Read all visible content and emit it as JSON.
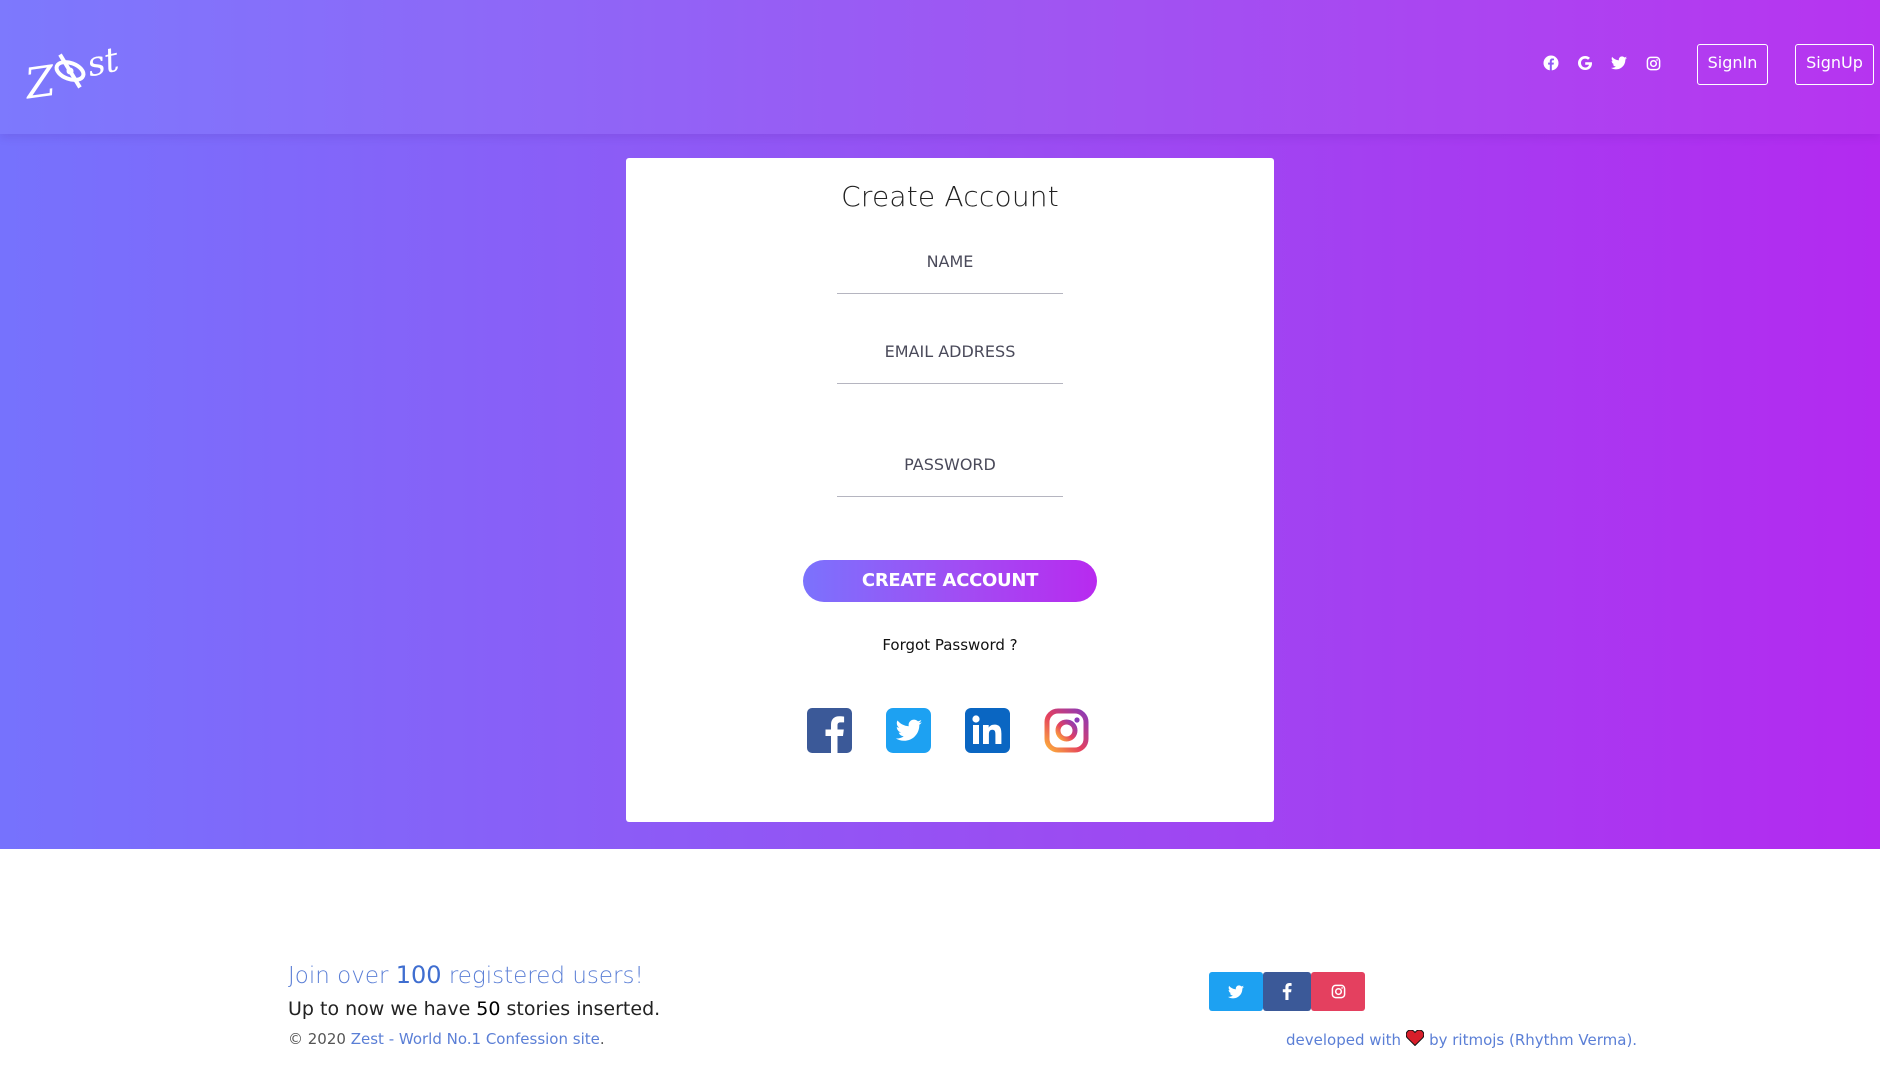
{
  "header": {
    "logo_text": "Zest",
    "social_icons": [
      "facebook-icon",
      "google-icon",
      "twitter-icon",
      "instagram-icon"
    ],
    "signin_label": "SignIn",
    "signup_label": "SignUp"
  },
  "form": {
    "title": "Create Account",
    "name_label": "NAME",
    "email_label": "EMAIL ADDRESS",
    "password_label": "PASSWORD",
    "submit_label": "CREATE ACCOUNT",
    "forgot_label": "Forgot Password ?",
    "social_icons": [
      "facebook-square-icon",
      "twitter-square-icon",
      "linkedin-square-icon",
      "instagram-square-icon"
    ]
  },
  "footer": {
    "join_prefix": "Join over ",
    "join_count": "100",
    "join_suffix": " registered users!",
    "stories_prefix": "Up to now we have ",
    "stories_count": "50",
    "stories_suffix": " stories inserted.",
    "copy_prefix": "© 2020 ",
    "copy_link": "Zest - World No.1 Confession site",
    "copy_suffix": ".",
    "dev_prefix": "developed with",
    "dev_suffix": "by ritmojs (Rhythm Verma).",
    "share_buttons": [
      "twitter-icon",
      "facebook-icon",
      "instagram-icon"
    ]
  },
  "colors": {
    "gradient_start": "#7672fd",
    "gradient_end": "#b32af0",
    "link": "#5b7fd6",
    "twitter": "#1da1f2",
    "facebook": "#3b5998",
    "instagram": "#e4405f"
  }
}
